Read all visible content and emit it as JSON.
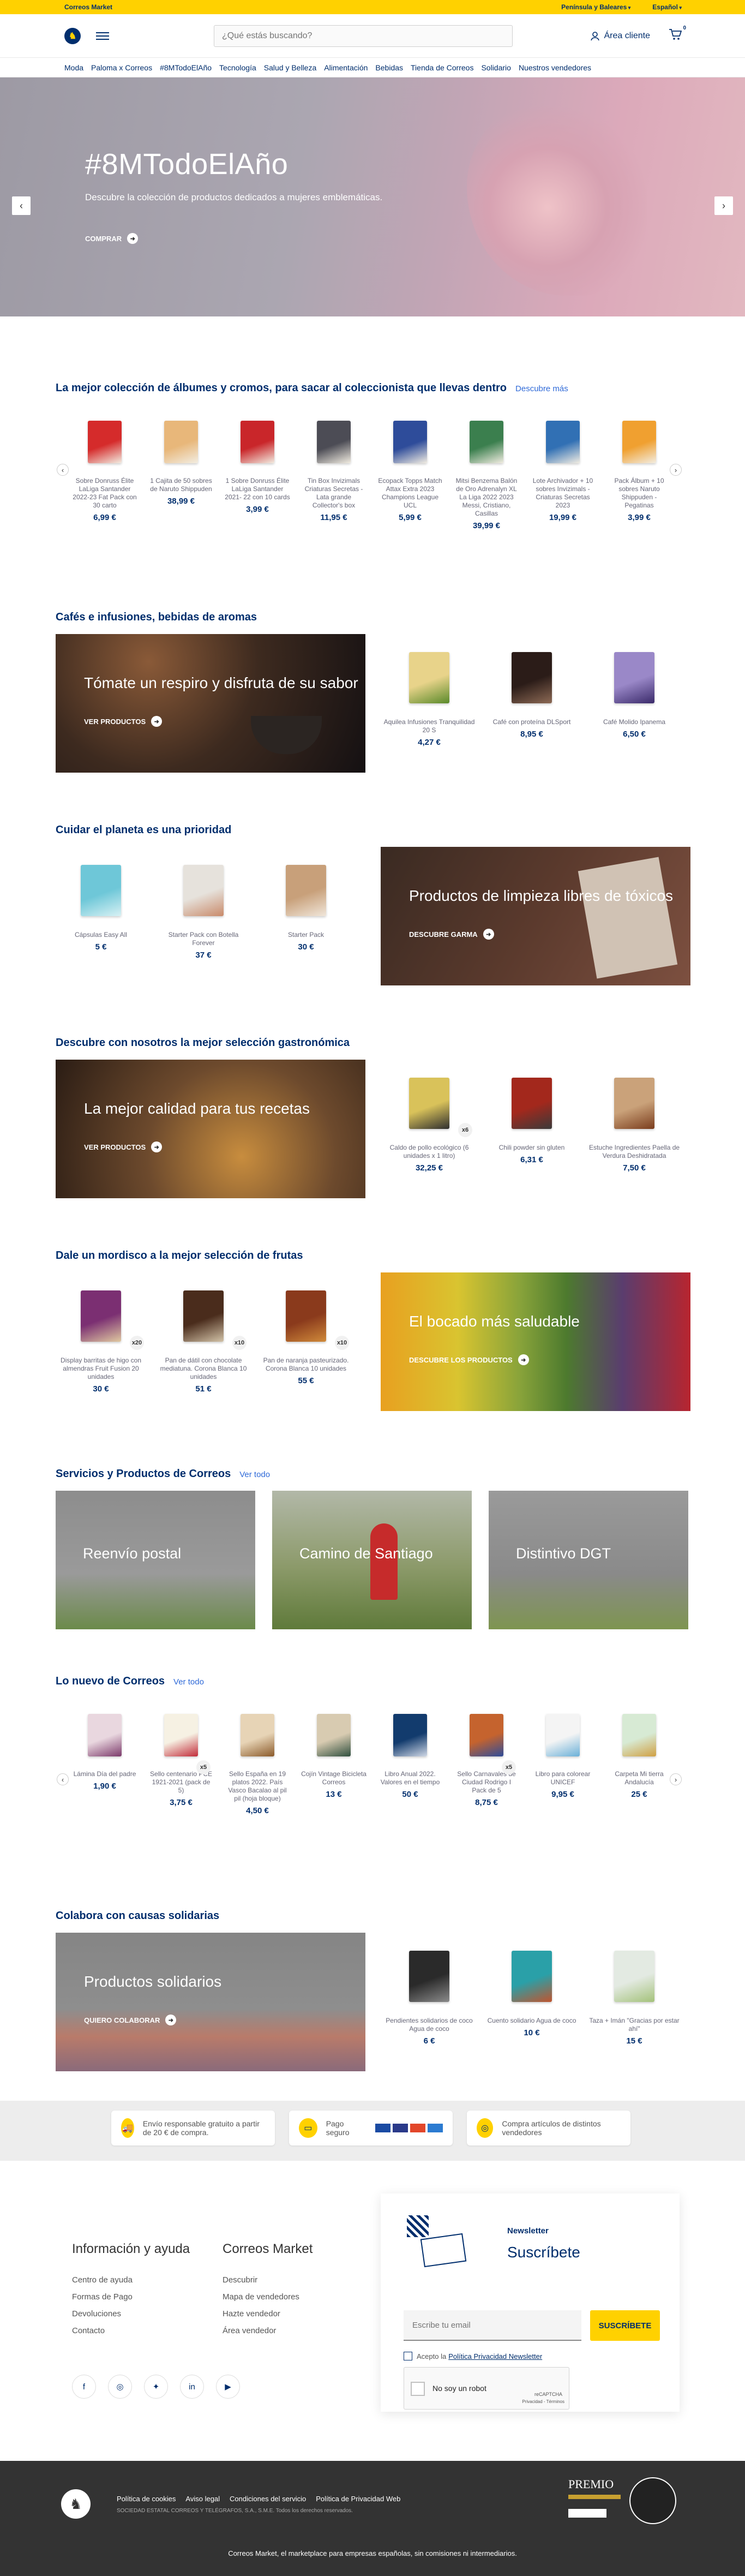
{
  "topbar": {
    "brand": "Correos Market",
    "region": "Península y Baleares",
    "language": "Español"
  },
  "header": {
    "search_placeholder": "¿Qué estás buscando?",
    "account": "Área cliente",
    "cart_count": "0"
  },
  "nav": [
    "Moda",
    "Paloma x Correos",
    "#8MTodoElAño",
    "Tecnología",
    "Salud y Belleza",
    "Alimentación",
    "Bebidas",
    "Tienda de Correos",
    "Solidario",
    "Nuestros vendedores"
  ],
  "hero": {
    "title": "#8MTodoElAño",
    "subtitle": "Descubre la colección de productos dedicados a mujeres emblemáticas.",
    "cta": "COMPRAR"
  },
  "albums": {
    "title": "La mejor colección de álbumes y cromos, para sacar al coleccionista que llevas dentro",
    "more": "Descubre más",
    "items": [
      {
        "name": "Sobre Donruss Élite LaLiga Santander 2022-23 Fat Pack con 30 carto",
        "price": "6,99 €",
        "color": "#d52b2b"
      },
      {
        "name": "1 Cajita de 50 sobres de Naruto Shippuden",
        "price": "38,99 €",
        "color": "#e8b77a"
      },
      {
        "name": "1 Sobre Donruss Élite LaLiga Santander 2021- 22 con 10 cards",
        "price": "3,99 €",
        "color": "#c9262a"
      },
      {
        "name": "Tin Box Invizimals Criaturas Secretas - Lata grande Collector's box",
        "price": "11,95 €",
        "color": "#4c4c55"
      },
      {
        "name": "Ecopack Topps Match Attax Extra 2023 Champions League UCL",
        "price": "5,99 €",
        "color": "#2e4c9a"
      },
      {
        "name": "Mitsi Benzema Balón de Oro Adrenalyn XL La Liga 2022 2023 Messi, Cristiano, Casillas",
        "price": "39,99 €",
        "color": "#3b7f4e"
      },
      {
        "name": "Lote Archivador + 10 sobres Invizimals - Criaturas Secretas 2023",
        "price": "19,99 €",
        "color": "#3170b4"
      },
      {
        "name": "Pack Álbum + 10 sobres Naruto Shippuden - Pegatinas",
        "price": "3,99 €",
        "color": "#f0a030"
      }
    ]
  },
  "coffee": {
    "title": "Cafés e infusiones, bebidas de aromas",
    "banner": "Tómate un respiro y disfruta de su sabor",
    "cta": "VER PRODUCTOS",
    "items": [
      {
        "name": "Aquilea Infusiones Tranquilidad 20 S",
        "price": "4,27 €"
      },
      {
        "name": "Café con proteína DLSport",
        "price": "8,95 €"
      },
      {
        "name": "Café Molido Ipanema",
        "price": "6,50 €"
      }
    ]
  },
  "planet": {
    "title": "Cuidar el planeta es una prioridad",
    "banner": "Productos de limpieza libres de tóxicos",
    "cta": "DESCUBRE GARMA",
    "items": [
      {
        "name": "Cápsulas Easy All",
        "price": "5 €"
      },
      {
        "name": "Starter Pack con Botella Forever",
        "price": "37 €"
      },
      {
        "name": "Starter Pack",
        "price": "30 €"
      }
    ]
  },
  "gastro": {
    "title": "Descubre con nosotros la mejor selección gastronómica",
    "banner": "La mejor calidad para tus recetas",
    "cta": "VER PRODUCTOS",
    "items": [
      {
        "name": "Caldo de pollo ecológico (6 unidades x 1 litro)",
        "price": "32,25 €",
        "badge": "x6"
      },
      {
        "name": "Chili powder sin gluten",
        "price": "6,31 €"
      },
      {
        "name": "Estuche Ingredientes Paella de Verdura Deshidratada",
        "price": "7,50 €"
      }
    ]
  },
  "fruit": {
    "title": "Dale un mordisco a la mejor selección de frutas",
    "banner": "El bocado más saludable",
    "cta": "DESCUBRE LOS PRODUCTOS",
    "items": [
      {
        "name": "Display barritas de higo con almendras Fruit Fusion 20 unidades",
        "price": "30 €",
        "badge": "x20"
      },
      {
        "name": "Pan de dátil con chocolate mediatuna. Corona Blanca 10 unidades",
        "price": "51 €",
        "badge": "x10"
      },
      {
        "name": "Pan de naranja pasteurizado. Corona Blanca 10 unidades",
        "price": "55 €",
        "badge": "x10"
      }
    ]
  },
  "services": {
    "title": "Servicios y Productos de Correos",
    "more": "Ver todo",
    "cards": [
      "Reenvío postal",
      "Camino de Santiago",
      "Distintivo DGT"
    ]
  },
  "news": {
    "title": "Lo nuevo de Correos",
    "more": "Ver todo",
    "items": [
      {
        "name": "Lámina Día del padre",
        "price": "1,90 €"
      },
      {
        "name": "Sello centenario PCE 1921-2021 (pack de 5)",
        "price": "3,75 €",
        "badge": "x5"
      },
      {
        "name": "Sello España en 19 platos 2022. País Vasco Bacalao al pil pil (hoja bloque)",
        "price": "4,50 €"
      },
      {
        "name": "Cojín Vintage Bicicleta Correos",
        "price": "13 €"
      },
      {
        "name": "Libro Anual 2022. Valores en el tiempo",
        "price": "50 €"
      },
      {
        "name": "Sello Carnavales de Ciudad Rodrigo I Pack de 5",
        "price": "8,75 €",
        "badge": "x5"
      },
      {
        "name": "Libro para colorear UNICEF",
        "price": "9,95 €"
      },
      {
        "name": "Carpeta Mi tierra Andalucía",
        "price": "25 €"
      }
    ]
  },
  "solidarity": {
    "title": "Colabora con causas solidarias",
    "banner": "Productos solidarios",
    "cta": "QUIERO COLABORAR",
    "items": [
      {
        "name": "Pendientes solidarios de coco Agua de coco",
        "price": "6 €"
      },
      {
        "name": "Cuento solidario Agua de coco",
        "price": "10 €"
      },
      {
        "name": "Taza + Imán \"Gracias por estar ahí\"",
        "price": "15 €"
      }
    ]
  },
  "benefits": [
    {
      "text": "Envío responsable gratuito a partir de 20 € de compra."
    },
    {
      "text": "Pago seguro"
    },
    {
      "text": "Compra artículos de distintos vendedores"
    }
  ],
  "footer": {
    "info_title": "Información y ayuda",
    "info_links": [
      "Centro de ayuda",
      "Formas de Pago",
      "Devoluciones",
      "Contacto"
    ],
    "market_title": "Correos Market",
    "market_links": [
      "Descubrir",
      "Mapa de vendedores",
      "Hazte vendedor",
      "Área vendedor"
    ],
    "newsletter_label": "Newsletter",
    "newsletter_title": "Suscríbete",
    "email_placeholder": "Escribe tu email",
    "subscribe": "SUSCRÍBETE",
    "accept_prefix": "Acepto la ",
    "privacy_link": "Política Privacidad Newsletter",
    "captcha": "No soy un robot",
    "captcha_brand": "reCAPTCHA",
    "captcha_terms": "Privacidad - Términos",
    "legal_links": [
      "Política de cookies",
      "Aviso legal",
      "Condiciones del servicio",
      "Política de Privacidad Web"
    ],
    "copyright": "SOCIEDAD ESTATAL CORREOS Y TELÉGRAFOS, S.A., S.M.E. Todos los derechos reservados.",
    "award_title": "PREMIO",
    "tagline": "Correos Market, el marketplace para empresas españolas, sin comisiones ni intermediarios."
  }
}
